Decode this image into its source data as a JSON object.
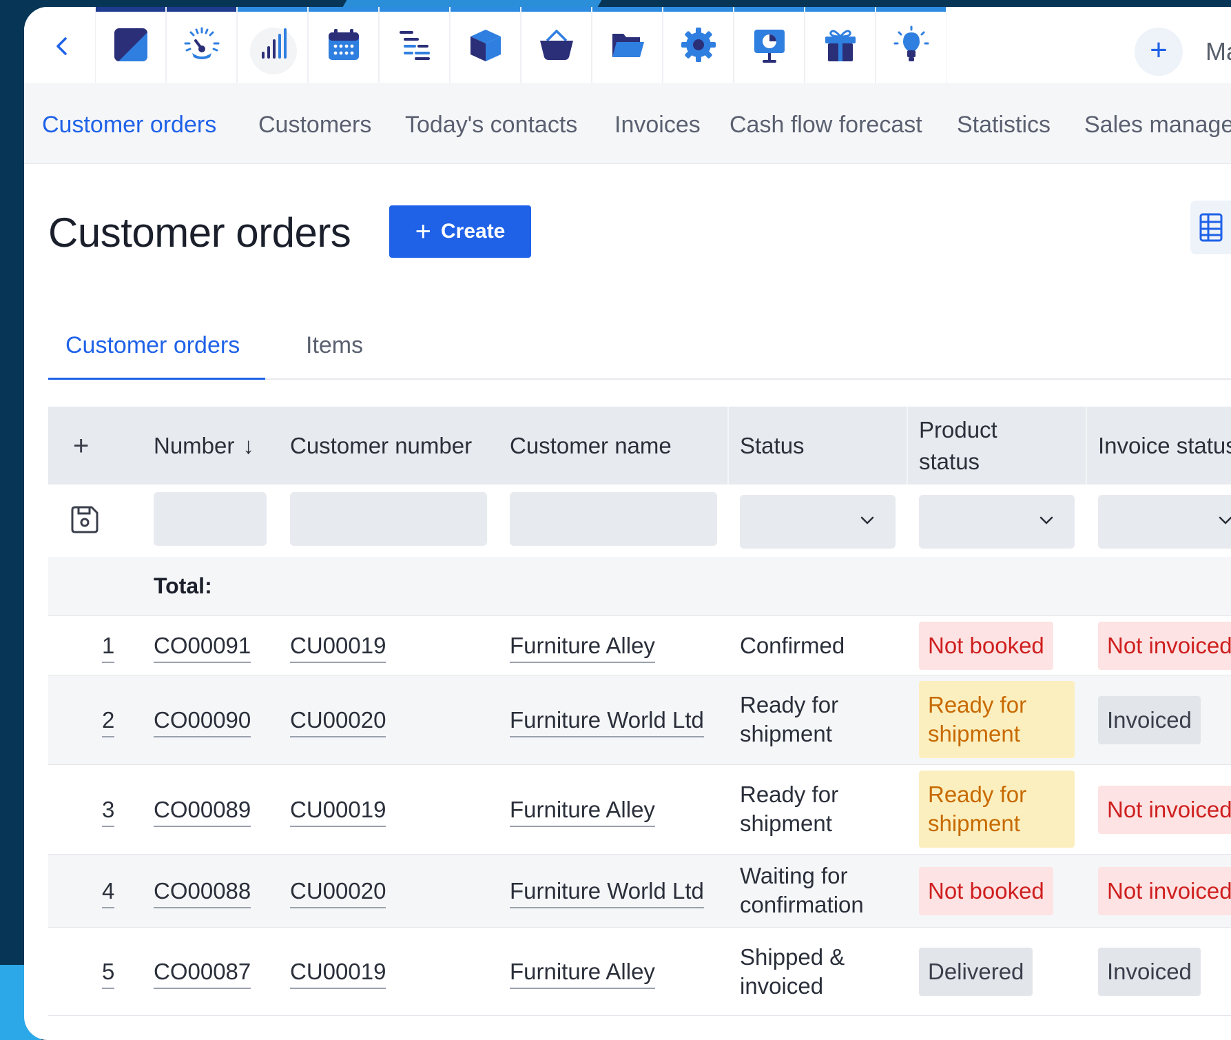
{
  "colors": {
    "accent": "#1f62e8",
    "background": "#063556",
    "badge_red_bg": "#fde3e3",
    "badge_red_text": "#cf1f1f",
    "badge_amber_bg": "#fcefbf",
    "badge_amber_text": "#c76a00",
    "badge_gray_bg": "#e2e5ea"
  },
  "appbar": {
    "back_icon": "chevron-left-icon",
    "apps": [
      {
        "icon": "brand-logo-icon"
      },
      {
        "icon": "dashboard-gauge-icon"
      },
      {
        "icon": "statistics-chart-icon",
        "selected": true
      },
      {
        "icon": "calendar-icon"
      },
      {
        "icon": "gantt-list-icon"
      },
      {
        "icon": "inventory-cube-icon"
      },
      {
        "icon": "shopping-basket-icon"
      },
      {
        "icon": "folder-open-icon"
      },
      {
        "icon": "settings-gear-icon"
      },
      {
        "icon": "presentation-board-icon"
      },
      {
        "icon": "gift-icon"
      },
      {
        "icon": "lightbulb-icon"
      }
    ],
    "add_label": "+",
    "more_label": "Ma"
  },
  "modnav": {
    "items": [
      {
        "label": "Customer orders",
        "active": true
      },
      {
        "label": "Customers"
      },
      {
        "label": "Today's contacts"
      },
      {
        "label": "Invoices"
      },
      {
        "label": "Cash flow forecast"
      },
      {
        "label": "Statistics"
      },
      {
        "label": "Sales manage"
      }
    ]
  },
  "page": {
    "title": "Customer orders",
    "create_label": "Create",
    "create_plus": "+"
  },
  "subtabs": [
    {
      "label": "Customer orders",
      "active": true
    },
    {
      "label": "Items"
    }
  ],
  "grid": {
    "add_column": "+",
    "columns": {
      "number": "Number",
      "number_sort": "↓",
      "customer_number": "Customer number",
      "customer_name": "Customer name",
      "status": "Status",
      "product_status": "Product status",
      "invoice_status": "Invoice status"
    },
    "total_label": "Total:",
    "rows": [
      {
        "index": "1",
        "number": "CO00091",
        "customer_number": "CU00019",
        "customer_name": "Furniture Alley",
        "status": "Confirmed",
        "product_status": "Not booked",
        "product_tone": "red",
        "invoice_status": "Not invoiced",
        "invoice_tone": "red"
      },
      {
        "index": "2",
        "number": "CO00090",
        "customer_number": "CU00020",
        "customer_name": "Furniture World Ltd",
        "status": "Ready for shipment",
        "product_status": "Ready for shipment",
        "product_tone": "amber",
        "invoice_status": "Invoiced",
        "invoice_tone": "gray"
      },
      {
        "index": "3",
        "number": "CO00089",
        "customer_number": "CU00019",
        "customer_name": "Furniture Alley",
        "status": "Ready for shipment",
        "product_status": "Ready for shipment",
        "product_tone": "amber",
        "invoice_status": "Not invoiced",
        "invoice_tone": "red"
      },
      {
        "index": "4",
        "number": "CO00088",
        "customer_number": "CU00020",
        "customer_name": "Furniture World Ltd",
        "status": "Waiting for confirmation",
        "product_status": "Not booked",
        "product_tone": "red",
        "invoice_status": "Not invoiced",
        "invoice_tone": "red"
      },
      {
        "index": "5",
        "number": "CO00087",
        "customer_number": "CU00019",
        "customer_name": "Furniture Alley",
        "status": "Shipped & invoiced",
        "product_status": "Delivered",
        "product_tone": "gray",
        "invoice_status": "Invoiced",
        "invoice_tone": "gray"
      }
    ]
  }
}
